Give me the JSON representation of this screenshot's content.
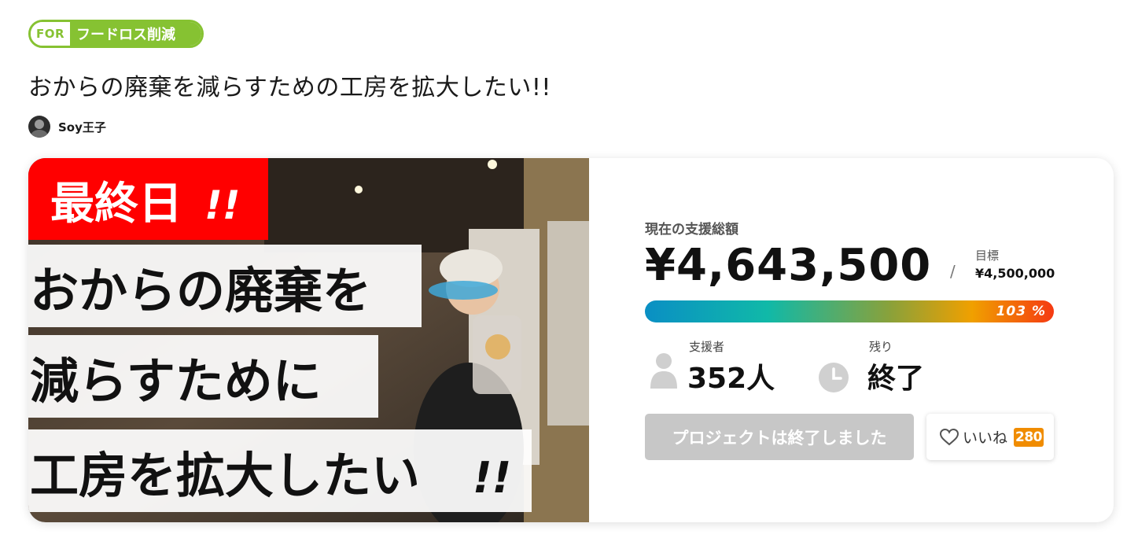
{
  "tag": {
    "prefix": "FOR",
    "label": "フードロス削減"
  },
  "project": {
    "title": "おからの廃棄を減らすための工房を拡大したい!!"
  },
  "owner": {
    "name": "Soy王子"
  },
  "thumbnail": {
    "badge": "最終日",
    "badge_mark": "!!",
    "line1": "おからの廃棄を",
    "line2": "減らすために",
    "line3": "工房を拡大したい",
    "line3_mark": "!!"
  },
  "funding": {
    "current_label": "現在の支援総額",
    "current_amount": "¥4,643,500",
    "separator": "/",
    "goal_label": "目標",
    "goal_amount": "¥4,500,000",
    "percent": "103 %",
    "progress_fraction": 1.0
  },
  "supporters": {
    "label": "支援者",
    "value": "352人"
  },
  "remaining": {
    "label": "残り",
    "value": "終了"
  },
  "actions": {
    "ended_label": "プロジェクトは終了しました",
    "like_label": "いいね",
    "like_count": "280"
  },
  "colors": {
    "brand_green": "#86c232",
    "badge_red": "#ff0000",
    "like_orange": "#f08c00"
  }
}
